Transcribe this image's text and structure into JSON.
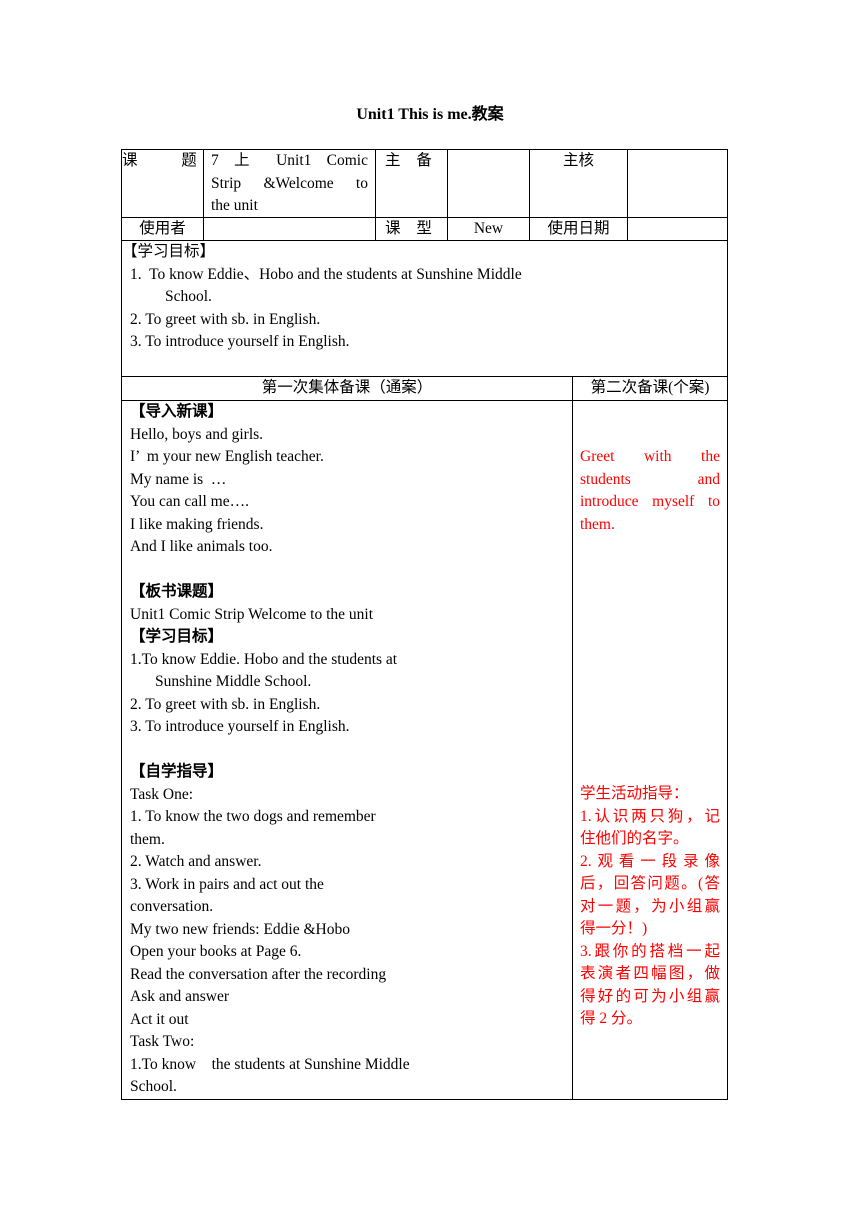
{
  "document": {
    "title": "Unit1 This is me.教案"
  },
  "header_table": {
    "row1": {
      "topic_label": "课  题",
      "topic_value_lines": [
        "7 上 Unit1 Comic",
        "Strip &Welcome to",
        "the unit"
      ],
      "main_prep_label": "主 备",
      "main_prep_value": "",
      "reviewer_label": "主核",
      "reviewer_value": ""
    },
    "row2": {
      "user_label": "使用者",
      "user_value": "",
      "lesson_type_label": "课 型",
      "lesson_type_value": "New",
      "use_date_label": "使用日期",
      "use_date_value": ""
    }
  },
  "objectives_section": {
    "heading": "【学习目标】",
    "items": [
      "1.  To know Eddie、Hobo and the students at Sunshine Middle",
      "School.",
      "2. To greet with sb. in English.",
      "3. To introduce yourself in English."
    ]
  },
  "columns": {
    "left_header": "第一次集体备课（通案）",
    "right_header": "第二次备课(个案)"
  },
  "left_column": {
    "lead_in_heading": "【导入新课】",
    "lead_in_lines": [
      "Hello, boys and girls.",
      "I’  m your new English teacher.",
      "My name is  …",
      "You can call me….",
      "I like making friends.",
      "And I like animals too."
    ],
    "board_heading": "【板书课题】",
    "board_title": "Unit1 Comic Strip Welcome to the unit",
    "objectives_heading": "【学习目标】",
    "objectives_lines": [
      "1.To know Eddie. Hobo and the students at",
      "Sunshine Middle School.",
      "2. To greet with sb. in English.",
      "3. To introduce yourself in English."
    ],
    "self_study_heading": "【自学指导】",
    "self_study_lines": [
      "Task One:",
      "1. To know the two dogs and remember",
      "them.",
      "2. Watch and answer.",
      "3. Work in pairs and act out the",
      "conversation.",
      "My two new friends: Eddie &Hobo",
      "Open your books at Page 6.",
      "Read the conversation after the recording",
      "Ask and answer",
      "Act it out",
      "Task Two:",
      "1.To know    the students at Sunshine Middle",
      "School."
    ]
  },
  "right_column": {
    "note1_lines": [
      "Greet with the",
      "students and",
      "introduce myself to",
      "them."
    ],
    "note2_lines": [
      "学生活动指导：",
      "1.认识两只狗，记",
      "住他们的名字。",
      "2.观看一段录像",
      "后，回答问题。(答",
      "对一题，为小组赢",
      "得一分！)",
      "3.跟你的搭档一起",
      "表演者四幅图，做",
      "得好的可为小组赢",
      "得 2 分。"
    ],
    "note_color": "#ff0000"
  }
}
